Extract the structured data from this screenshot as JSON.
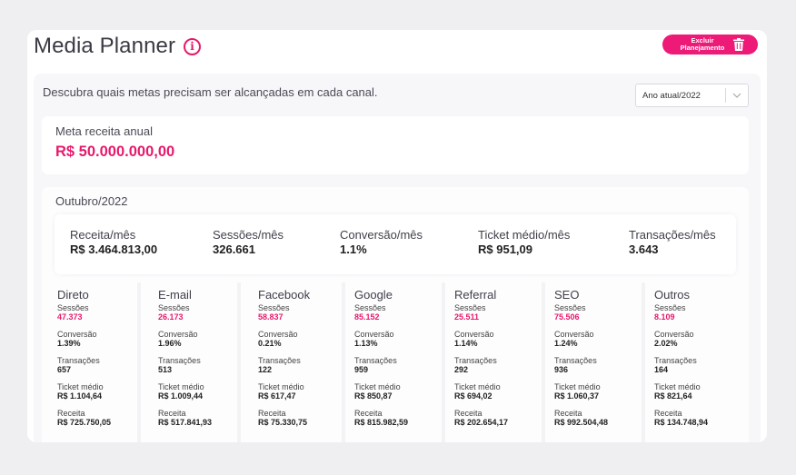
{
  "header": {
    "title": "Media Planner",
    "delete_button_label": "Excluir Planejamento"
  },
  "intro": {
    "text": "Descubra quais metas precisam ser alcançadas em cada canal.",
    "period_select": {
      "value": "Ano atual/2022"
    }
  },
  "annual_goal": {
    "label": "Meta receita anual",
    "value": "R$ 50.000.000,00"
  },
  "month": {
    "label": "Outubro/2022",
    "summary": [
      {
        "label": "Receita/mês",
        "value": "R$ 3.464.813,00"
      },
      {
        "label": "Sessões/mês",
        "value": "326.661"
      },
      {
        "label": "Conversão/mês",
        "value": "1.1%"
      },
      {
        "label": "Ticket médio/mês",
        "value": "R$ 951,09"
      },
      {
        "label": "Transações/mês",
        "value": "3.643"
      }
    ],
    "metric_labels": {
      "sessions": "Sessões",
      "conversion": "Conversão",
      "transactions": "Transações",
      "ticket": "Ticket médio",
      "revenue": "Receita"
    },
    "channels": [
      {
        "name": "Direto",
        "sessions": "47.373",
        "conversion": "1.39%",
        "transactions": "657",
        "ticket": "R$ 1.104,64",
        "revenue": "R$ 725.750,05"
      },
      {
        "name": "E-mail",
        "sessions": "26.173",
        "conversion": "1.96%",
        "transactions": "513",
        "ticket": "R$ 1.009,44",
        "revenue": "R$ 517.841,93"
      },
      {
        "name": "Facebook",
        "sessions": "58.837",
        "conversion": "0.21%",
        "transactions": "122",
        "ticket": "R$ 617,47",
        "revenue": "R$ 75.330,75"
      },
      {
        "name": "Google",
        "sessions": "85.152",
        "conversion": "1.13%",
        "transactions": "959",
        "ticket": "R$ 850,87",
        "revenue": "R$ 815.982,59"
      },
      {
        "name": "Referral",
        "sessions": "25.511",
        "conversion": "1.14%",
        "transactions": "292",
        "ticket": "R$ 694,02",
        "revenue": "R$ 202.654,17"
      },
      {
        "name": "SEO",
        "sessions": "75.506",
        "conversion": "1.24%",
        "transactions": "936",
        "ticket": "R$ 1.060,37",
        "revenue": "R$ 992.504,48"
      },
      {
        "name": "Outros",
        "sessions": "8.109",
        "conversion": "2.02%",
        "transactions": "164",
        "ticket": "R$ 821,64",
        "revenue": "R$ 134.748,94"
      }
    ]
  },
  "colors": {
    "accent": "#e8196c",
    "button": "#ee1a78",
    "background": "#efeff1"
  },
  "icons": {
    "info": "info-circle-icon",
    "delete": "trash-icon",
    "select": "chevron-down-icon"
  }
}
